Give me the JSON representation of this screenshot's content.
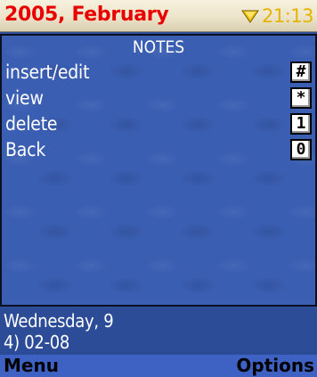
{
  "header": {
    "title": "2005, February",
    "time": "21:13",
    "status_icon": "battery-icon",
    "title_color": "#e80000",
    "time_color": "#e5b400"
  },
  "panel": {
    "title": "NOTES",
    "items": [
      {
        "label": "insert/edit",
        "key": "#"
      },
      {
        "label": "view",
        "key": "*"
      },
      {
        "label": "delete",
        "key": "1"
      },
      {
        "label": "Back",
        "key": "0"
      }
    ]
  },
  "info": {
    "line1": "Wednesday, 9",
    "line2": "4) 02-08"
  },
  "softkeys": {
    "left": "Menu",
    "right": "Options"
  },
  "colors": {
    "background": "#3a5eb2",
    "softkey_bar": "#3d62c4"
  }
}
